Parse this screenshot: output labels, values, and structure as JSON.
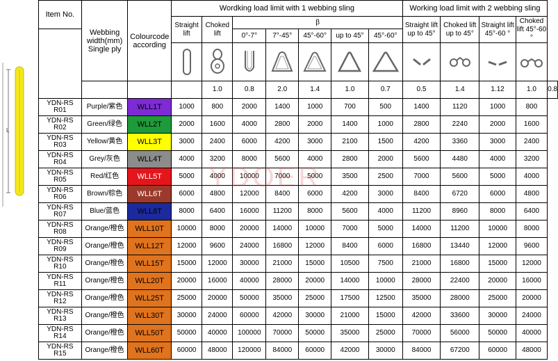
{
  "sling_label": "L",
  "watermark": "YDOER",
  "header": {
    "item_no": "Item No.",
    "webbing": "Webbing width(mm) Single ply",
    "colour": "Colourcode according",
    "group1": "Wordking load limit with 1 webbing sling",
    "group2": "Working load limit with 2 webbing sling",
    "beta": "β",
    "straight_lift": "Straight lift",
    "choked_lift": "Choked lift",
    "b_0_7": "0°-7°",
    "b_7_45": "7°-45°",
    "b_45_60": "45°-60°",
    "b_up45": "up to 45°",
    "b_45_60b": "45°-60°",
    "s2_straight": "Straight lift up to 45°",
    "s2_choked": "Choked lift up to 45°",
    "s2_straight_45_60": "Straight lift 45°-60 °",
    "s2_choked_45_60": "Choked lift 45°-60 °"
  },
  "factors": [
    "1.0",
    "0.8",
    "2.0",
    "1.4",
    "1.0",
    "0.7",
    "0.5",
    "1.4",
    "1.12",
    "1.0",
    "0.8"
  ],
  "colors": {
    "Purple": "#7e2bd6",
    "Green": "#1f9a3a",
    "Yellow": "#ffff00",
    "Grey": "#8c8c8c",
    "Red": "#e4161c",
    "Brown": "#9b3a2b",
    "Blue": "#1c2a9e",
    "Orange": "#e0731d"
  },
  "rows": [
    {
      "item": "YDN-RSR01",
      "webbing": "Purple/紫色",
      "color_key": "Purple",
      "code": "WLL1T",
      "v": [
        "1000",
        "800",
        "2000",
        "1400",
        "1000",
        "700",
        "500",
        "1400",
        "1120",
        "1000",
        "800"
      ]
    },
    {
      "item": "YDN-RSR02",
      "webbing": "Green/绿色",
      "color_key": "Green",
      "code": "WLL2T",
      "v": [
        "2000",
        "1600",
        "4000",
        "2800",
        "2000",
        "1400",
        "1000",
        "2800",
        "2240",
        "2000",
        "1600"
      ]
    },
    {
      "item": "YDN-RSR03",
      "webbing": "Yellow/黄色",
      "color_key": "Yellow",
      "code": "WLL3T",
      "v": [
        "3000",
        "2400",
        "6000",
        "4200",
        "3000",
        "2100",
        "1500",
        "4200",
        "3360",
        "3000",
        "2400"
      ]
    },
    {
      "item": "YDN-RSR04",
      "webbing": "Grey/灰色",
      "color_key": "Grey",
      "code": "WLL4T",
      "v": [
        "4000",
        "3200",
        "8000",
        "5600",
        "4000",
        "2800",
        "2000",
        "5600",
        "4480",
        "4000",
        "3200"
      ]
    },
    {
      "item": "YDN-RSR05",
      "webbing": "Red/红色",
      "color_key": "Red",
      "code": "WLL5T",
      "v": [
        "5000",
        "4000",
        "10000",
        "7000",
        "5000",
        "3500",
        "2500",
        "7000",
        "5600",
        "5000",
        "4000"
      ]
    },
    {
      "item": "YDN-RSR06",
      "webbing": "Brown/棕色",
      "color_key": "Brown",
      "code": "WLL6T",
      "v": [
        "6000",
        "4800",
        "12000",
        "8400",
        "6000",
        "4200",
        "3000",
        "8400",
        "6720",
        "6000",
        "4800"
      ]
    },
    {
      "item": "YDN-RSR07",
      "webbing": "Blue/蓝色",
      "color_key": "Blue",
      "code": "WLL8T",
      "v": [
        "8000",
        "6400",
        "16000",
        "11200",
        "8000",
        "5600",
        "4000",
        "11200",
        "8960",
        "8000",
        "6400"
      ]
    },
    {
      "item": "YDN-RSR08",
      "webbing": "Orange/橙色",
      "color_key": "Orange",
      "code": "WLL10T",
      "v": [
        "10000",
        "8000",
        "20000",
        "14000",
        "10000",
        "7000",
        "5000",
        "14000",
        "11200",
        "10000",
        "8000"
      ]
    },
    {
      "item": "YDN-RSR09",
      "webbing": "Orange/橙色",
      "color_key": "Orange",
      "code": "WLL12T",
      "v": [
        "12000",
        "9600",
        "24000",
        "16800",
        "12000",
        "8400",
        "6000",
        "16800",
        "13440",
        "12000",
        "9600"
      ]
    },
    {
      "item": "YDN-RSR10",
      "webbing": "Orange/橙色",
      "color_key": "Orange",
      "code": "WLL15T",
      "v": [
        "15000",
        "12000",
        "30000",
        "21000",
        "15000",
        "10500",
        "7500",
        "21000",
        "16800",
        "15000",
        "12000"
      ]
    },
    {
      "item": "YDN-RSR11",
      "webbing": "Orange/橙色",
      "color_key": "Orange",
      "code": "WLL20T",
      "v": [
        "20000",
        "16000",
        "40000",
        "28000",
        "20000",
        "14000",
        "10000",
        "28000",
        "22400",
        "20000",
        "16000"
      ]
    },
    {
      "item": "YDN-RSR12",
      "webbing": "Orange/橙色",
      "color_key": "Orange",
      "code": "WLL25T",
      "v": [
        "25000",
        "20000",
        "50000",
        "35000",
        "25000",
        "17500",
        "12500",
        "35000",
        "28000",
        "25000",
        "20000"
      ]
    },
    {
      "item": "YDN-RSR13",
      "webbing": "Orange/橙色",
      "color_key": "Orange",
      "code": "WLL30T",
      "v": [
        "30000",
        "24000",
        "60000",
        "42000",
        "30000",
        "21000",
        "15000",
        "42000",
        "33600",
        "30000",
        "24000"
      ]
    },
    {
      "item": "YDN-RSR14",
      "webbing": "Orange/橙色",
      "color_key": "Orange",
      "code": "WLL50T",
      "v": [
        "50000",
        "40000",
        "100000",
        "70000",
        "50000",
        "35000",
        "25000",
        "70000",
        "56000",
        "50000",
        "40000"
      ]
    },
    {
      "item": "YDN-RSR15",
      "webbing": "Orange/橙色",
      "color_key": "Orange",
      "code": "WLL60T",
      "v": [
        "60000",
        "48000",
        "120000",
        "84000",
        "60000",
        "42000",
        "30000",
        "84000",
        "67200",
        "60000",
        "48000"
      ]
    }
  ]
}
